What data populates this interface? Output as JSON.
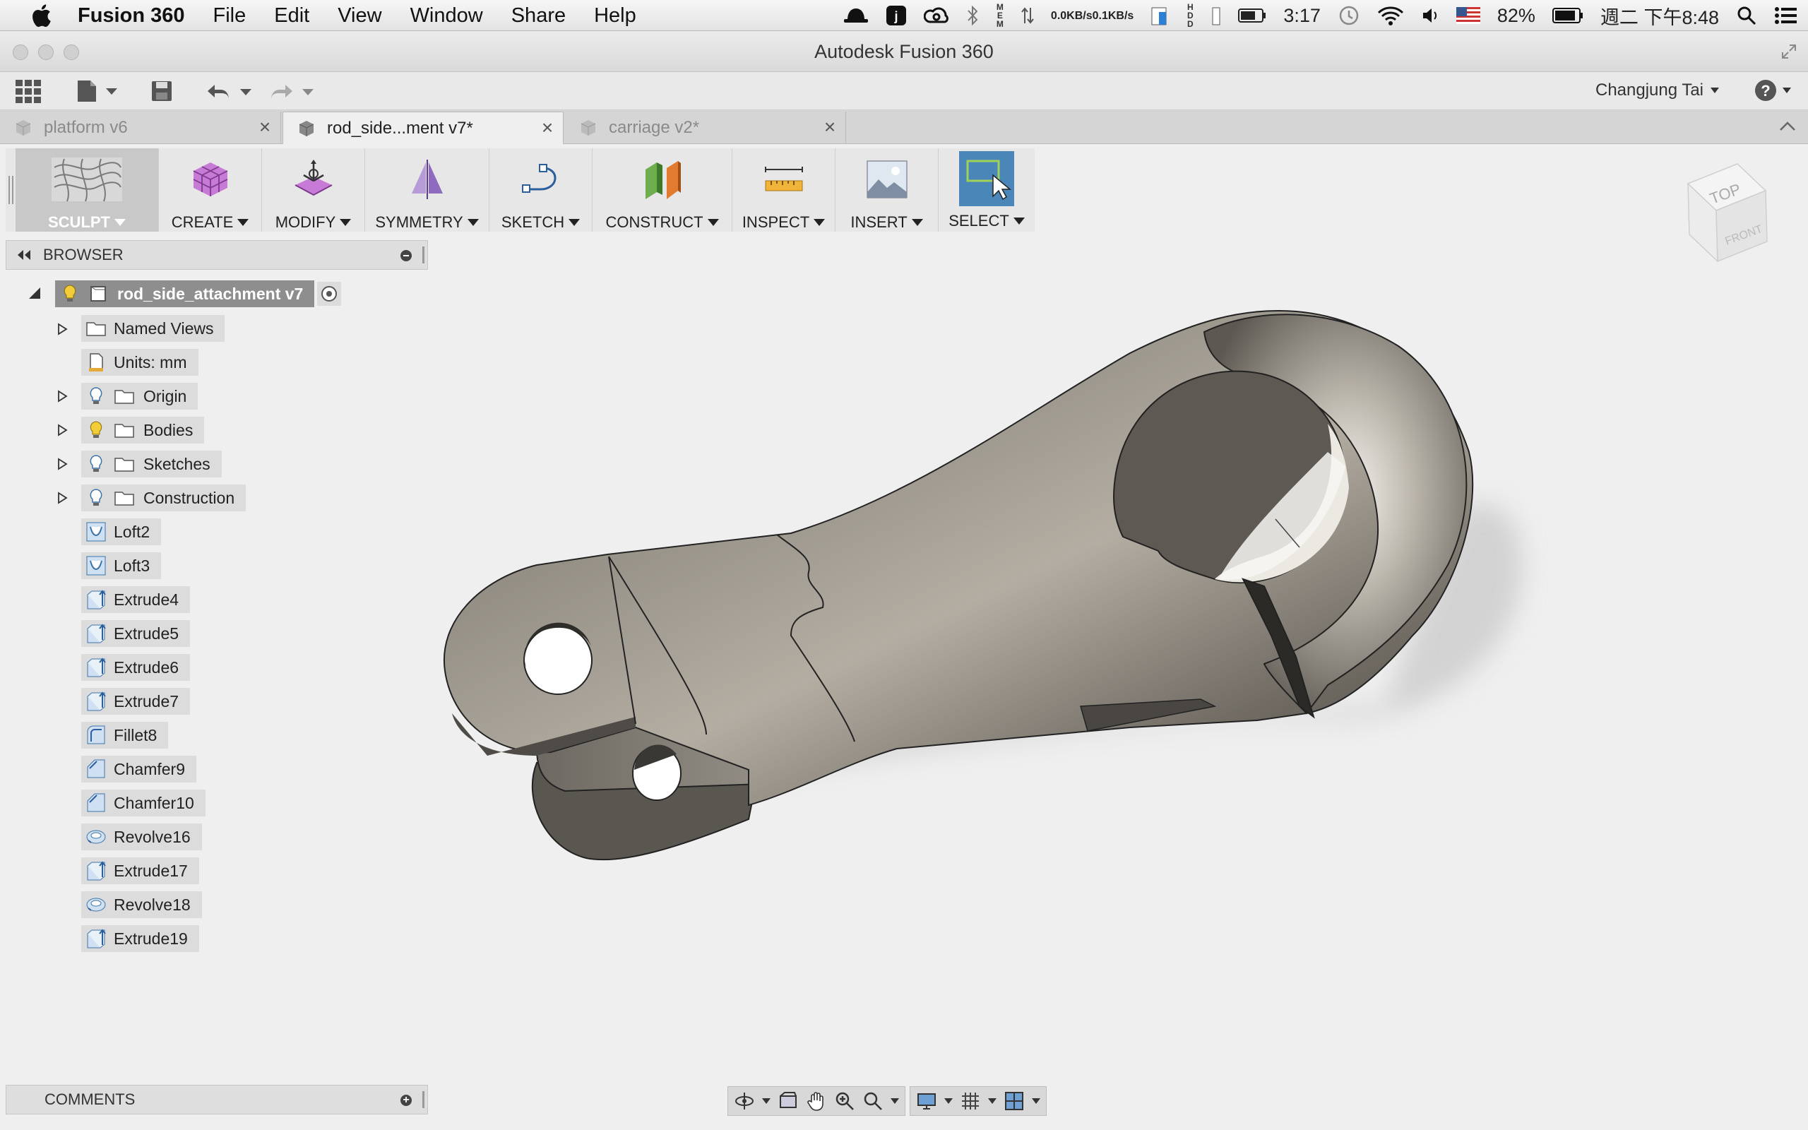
{
  "menubar": {
    "app_name": "Fusion 360",
    "items": [
      "File",
      "Edit",
      "View",
      "Window",
      "Share",
      "Help"
    ],
    "status": {
      "net_up": "0.0KB/s",
      "net_down": "0.1KB/s",
      "mem_label": "MEM",
      "hdd_label": "HDD",
      "battery_time": "3:17",
      "battery_percent": "82%",
      "datetime": "週二 下午8:48"
    }
  },
  "window": {
    "title": "Autodesk Fusion 360"
  },
  "account": {
    "user_name": "Changjung Tai"
  },
  "tabs": [
    {
      "label": "platform v6",
      "active": false
    },
    {
      "label": "rod_side...ment v7*",
      "active": true
    },
    {
      "label": "carriage v2*",
      "active": false
    }
  ],
  "ribbon": {
    "workspace": "SCULPT",
    "groups": [
      "CREATE",
      "MODIFY",
      "SYMMETRY",
      "SKETCH",
      "CONSTRUCT",
      "INSPECT",
      "INSERT",
      "SELECT"
    ]
  },
  "browser": {
    "title": "BROWSER",
    "root": "rod_side_attachment v7",
    "folders": [
      "Named Views",
      "Units: mm",
      "Origin",
      "Bodies",
      "Sketches",
      "Construction"
    ],
    "features": [
      "Loft2",
      "Loft3",
      "Extrude4",
      "Extrude5",
      "Extrude6",
      "Extrude7",
      "Fillet8",
      "Chamfer9",
      "Chamfer10",
      "Revolve16",
      "Extrude17",
      "Revolve18",
      "Extrude19"
    ]
  },
  "comments": {
    "title": "COMMENTS"
  },
  "viewcube": {
    "top": "TOP",
    "front": "FRONT"
  },
  "colors": {
    "accent_select": "#4a86b8",
    "node_bg": "#dcdcdc",
    "root_node_bg": "#8e8e8e"
  }
}
